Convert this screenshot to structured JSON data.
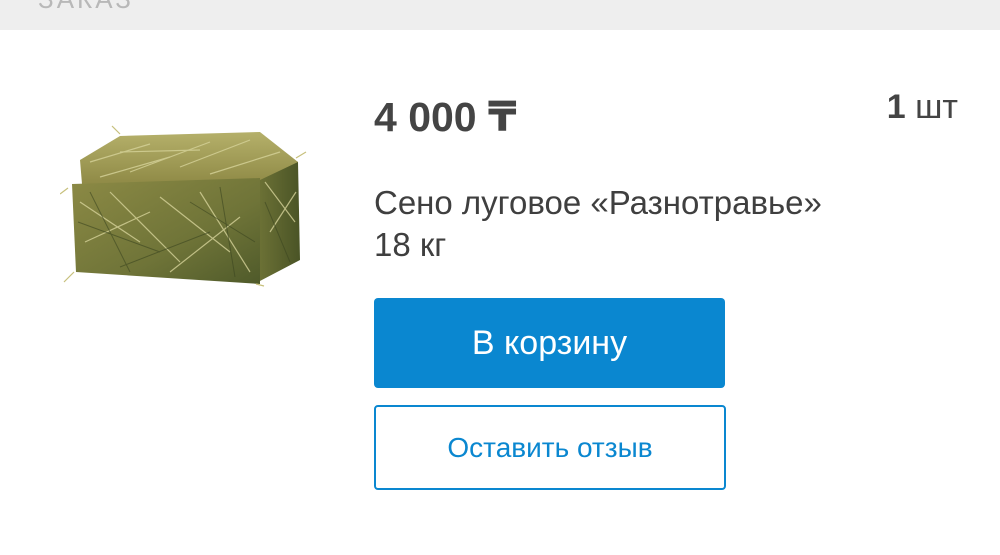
{
  "header": {
    "partial_label": "ЗАКАЗ"
  },
  "product": {
    "image": "hay-bale-photo",
    "price": "4 000 ₸",
    "quantity_number": "1",
    "quantity_unit": "шт",
    "name_line1": "Сено луговое «Разнотравье»",
    "name_line2": "18 кг"
  },
  "actions": {
    "cart_label": "В корзину",
    "review_label": "Оставить отзыв"
  },
  "colors": {
    "accent": "#0a87d0",
    "text": "#444444",
    "header_bg": "#eeeeee"
  }
}
